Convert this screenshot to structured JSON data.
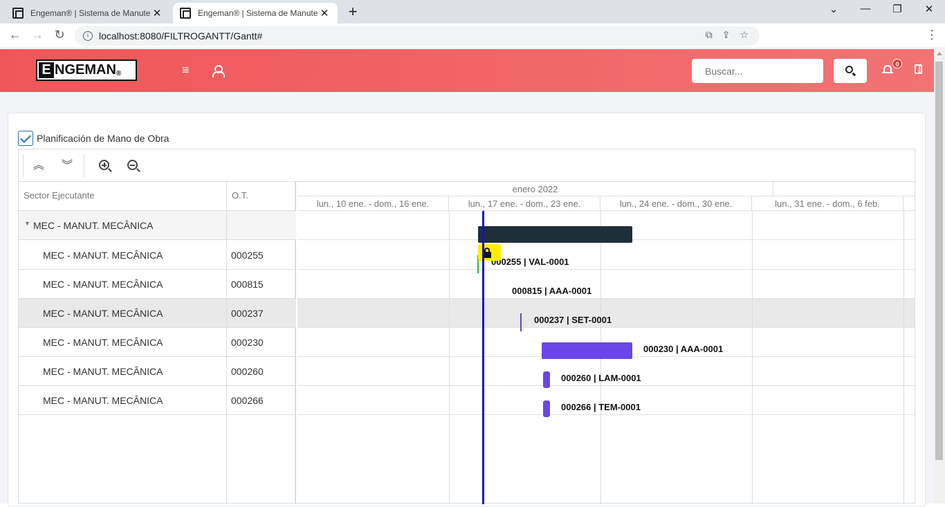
{
  "browser": {
    "tabs": [
      {
        "title": "Engeman® | Sistema de Manutenção",
        "active": false
      },
      {
        "title": "Engeman® | Sistema de Manutenção",
        "active": true
      }
    ],
    "url": "localhost:8080/FILTROGANTT/Gantt#",
    "icons": [
      "back-icon",
      "forward-icon",
      "reload-icon",
      "info-icon",
      "translate-icon",
      "share-icon",
      "star-icon",
      "kebab-menu-icon"
    ]
  },
  "header": {
    "logo_first": "E",
    "logo_rest": "NGEMAN",
    "logo_reg": "®",
    "search_placeholder": "Buscar...",
    "notification_count": "0",
    "colors": {
      "gradient_start": "#f05659",
      "gradient_end": "#f27375"
    }
  },
  "page": {
    "checkbox_label": "Planificación de Mano de Obra",
    "checkbox_checked": true
  },
  "gantt": {
    "columns": [
      "Sector Ejecutante",
      "O.T."
    ],
    "month_label": "enero 2022",
    "weeks": [
      "lun., 10 ene. - dom., 16 ene.",
      "lun., 17 ene. - dom., 23 ene.",
      "lun., 24 ene. - dom., 30 ene.",
      "lun., 31 ene. - dom., 6 feb."
    ],
    "group": {
      "name": "MEC - MANUT. MECÂNICA",
      "ot": ""
    },
    "rows": [
      {
        "name": "MEC - MANUT. MECÂNICA",
        "ot": "000255",
        "label": "000255 | VAL-0001",
        "color": "#2db82d"
      },
      {
        "name": "MEC - MANUT. MECÂNICA",
        "ot": "000815",
        "label": "000815 | AAA-0001",
        "color": "#ffee00"
      },
      {
        "name": "MEC - MANUT. MECÂNICA",
        "ot": "000237",
        "label": "000237 | SET-0001",
        "color": "#5b43e0"
      },
      {
        "name": "MEC - MANUT. MECÂNICA",
        "ot": "000230",
        "label": "000230 | AAA-0001",
        "color": "#6a46e6"
      },
      {
        "name": "MEC - MANUT. MECÂNICA",
        "ot": "000260",
        "label": "000260 | LAM-0001",
        "color": "#6a46e6"
      },
      {
        "name": "MEC - MANUT. MECÂNICA",
        "ot": "000266",
        "label": "000266 | TEM-0001",
        "color": "#6a46e6"
      }
    ],
    "summary_color": "#1f2f38",
    "today_color": "#1414c8"
  }
}
